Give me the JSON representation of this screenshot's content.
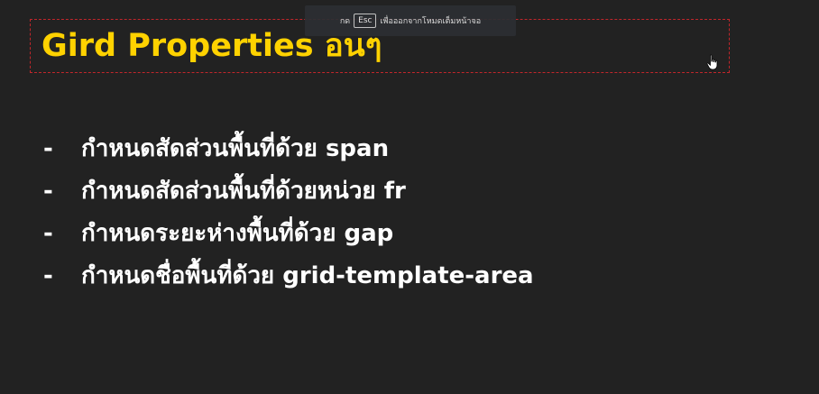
{
  "slide": {
    "title": "Gird Properties อนๆ",
    "bullets": [
      {
        "dash": "-",
        "text": "กำหนดสัดส่วนพื้นที่ด้วย span"
      },
      {
        "dash": "-",
        "text": "กำหนดสัดส่วนพื้นที่ด้วยหน่วย fr"
      },
      {
        "dash": "-",
        "text": "กำหนดระยะห่างพื้นที่ด้วย gap"
      },
      {
        "dash": "-",
        "text": "กำหนดชื่อพื้นที่ด้วย grid-template-area"
      }
    ]
  },
  "fullscreen_notice": {
    "prefix": "กด",
    "key": "Esc",
    "suffix": "เพื่อออกจากโหมดเต็มหน้าจอ"
  },
  "colors": {
    "background": "#222222",
    "title": "#ffd200",
    "text": "#ffffff",
    "selection_border": "#c2262b"
  },
  "icons": {
    "cursor": "hand-pointer-icon"
  }
}
